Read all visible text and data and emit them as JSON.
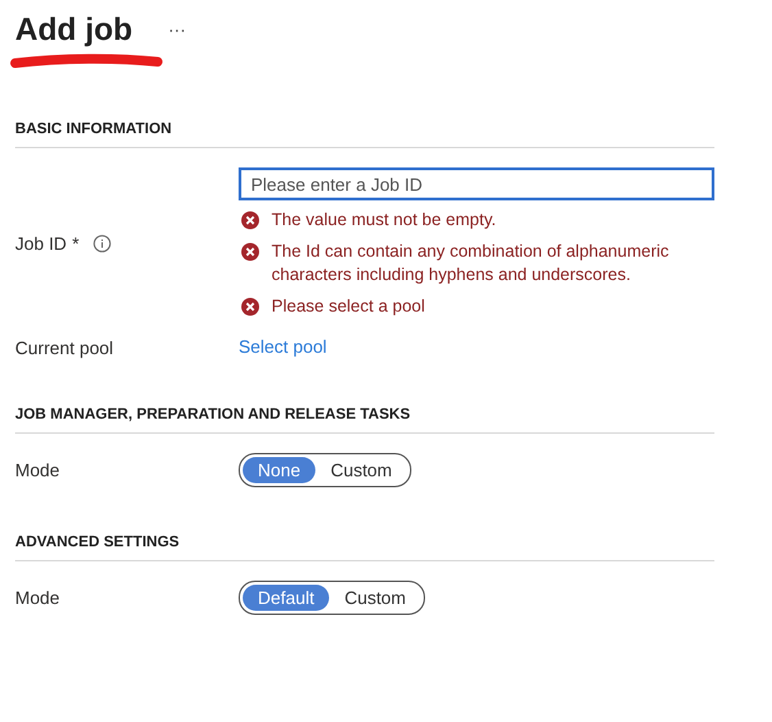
{
  "title": "Add job",
  "more": "···",
  "sections": [
    {
      "heading": "BASIC INFORMATION",
      "fields": [
        {
          "kind": "input",
          "label": "Job ID",
          "required": "*",
          "info": true,
          "placeholder": "Please enter a Job ID",
          "errors": [
            "The value must not be empty.",
            "The Id can contain any combination of alphanumeric characters including hyphens and underscores.",
            "Please select a pool"
          ]
        },
        {
          "kind": "link",
          "label": "Current pool",
          "link": "Select pool"
        }
      ]
    },
    {
      "heading": "JOB MANAGER, PREPARATION AND RELEASE TASKS",
      "fields": [
        {
          "kind": "toggle",
          "label": "Mode",
          "options": [
            {
              "label": "None",
              "selected": true
            },
            {
              "label": "Custom",
              "selected": false
            }
          ]
        }
      ]
    },
    {
      "heading": "ADVANCED SETTINGS",
      "fields": [
        {
          "kind": "toggle",
          "label": "Mode",
          "options": [
            {
              "label": "Default",
              "selected": true
            },
            {
              "label": "Custom",
              "selected": false
            }
          ]
        }
      ]
    }
  ]
}
